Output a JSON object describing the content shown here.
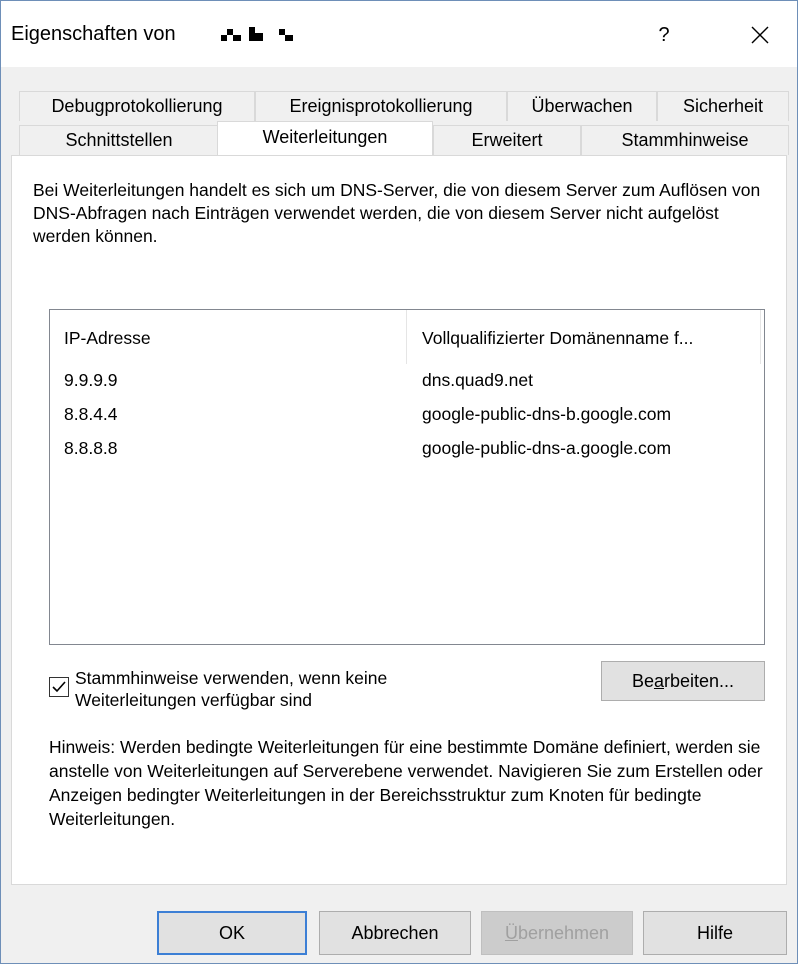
{
  "window": {
    "title": "Eigenschaften von",
    "help_label": "?",
    "close_icon": "close-icon"
  },
  "tabs": {
    "row1": [
      "Debugprotokollierung",
      "Ereignisprotokollierung",
      "Überwachen",
      "Sicherheit"
    ],
    "row2": [
      "Schnittstellen",
      "Weiterleitungen",
      "Erweitert",
      "Stammhinweise"
    ],
    "selected": "Weiterleitungen"
  },
  "panel": {
    "intro": "Bei Weiterleitungen handelt es sich um DNS-Server, die von diesem Server zum Auflösen von DNS-Abfragen nach Einträgen verwendet werden, die von diesem Server nicht aufgelöst werden können.",
    "columns": [
      "IP-Adresse",
      "Vollqualifizierter Domänenname f..."
    ],
    "rows": [
      {
        "ip": "9.9.9.9",
        "fqdn": "dns.quad9.net"
      },
      {
        "ip": "8.8.4.4",
        "fqdn": "google-public-dns-b.google.com"
      },
      {
        "ip": "8.8.8.8",
        "fqdn": "google-public-dns-a.google.com"
      }
    ],
    "checkbox_label": "Stammhinweise verwenden, wenn keine Weiterleitungen verfügbar sind",
    "checkbox_checked": true,
    "edit_button": {
      "pre": "Be",
      "accel": "a",
      "post": "rbeiten..."
    },
    "hint": "Hinweis: Werden bedingte Weiterleitungen für eine bestimmte Domäne definiert, werden sie anstelle von Weiterleitungen auf Serverebene verwendet. Navigieren Sie zum Erstellen oder Anzeigen bedingter Weiterleitungen in der Bereichsstruktur zum Knoten für bedingte Weiterleitungen."
  },
  "footer": {
    "ok": "OK",
    "cancel": "Abbrechen",
    "apply": {
      "accel": "Ü",
      "post": "bernehmen"
    },
    "help": "Hilfe"
  },
  "colors": {
    "accent": "#3c7fd5",
    "border": "#6e8fb8"
  }
}
